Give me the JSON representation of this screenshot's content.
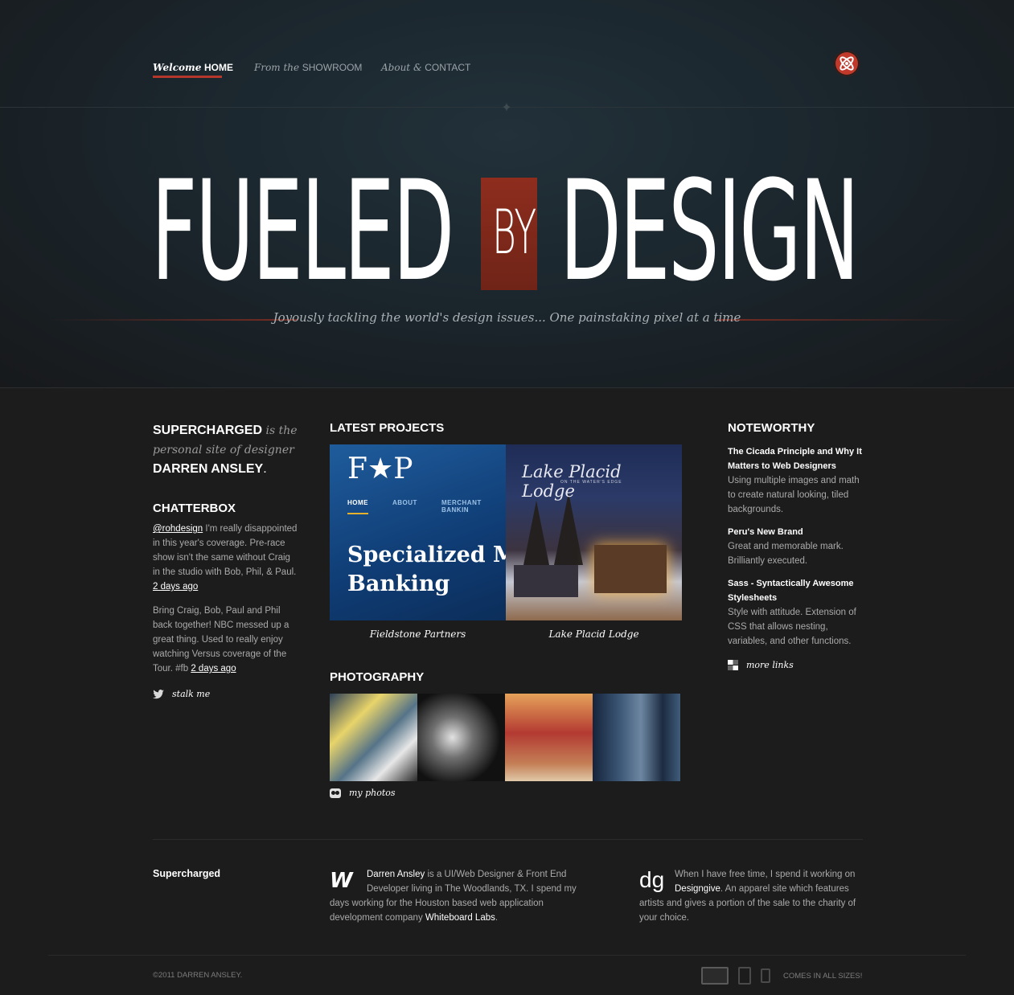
{
  "nav": {
    "items": [
      {
        "pre": "Welcome",
        "main": "HOME",
        "active": true
      },
      {
        "pre": "From the",
        "main": "SHOWROOM",
        "active": false
      },
      {
        "pre": "About &",
        "main": "CONTACT",
        "active": false
      }
    ],
    "logo_icon": "atom-logo-icon"
  },
  "hero": {
    "title_left": "FUELED",
    "title_by": "BY",
    "title_right": "DESIGN",
    "tagline": "Joyously tackling the world's design issues... One painstaking pixel at a time"
  },
  "intro": {
    "part1": "SUPERCHARGED",
    "part2": "is the personal site of designer",
    "part3": "DARREN ANSLEY",
    "part4": "."
  },
  "chatterbox": {
    "title": "CHATTERBOX",
    "tweets": [
      {
        "handle": "@rohdesign",
        "text": "I'm really disappointed in this year's coverage. Pre-race show isn't the same without Craig in the studio with Bob, Phil, & Paul.",
        "time": "2 days ago"
      },
      {
        "text": "Bring Craig, Bob, Paul and Phil back together! NBC messed up a great thing. Used to really enjoy watching Versus coverage of the Tour. #fb",
        "time": "2 days ago"
      }
    ],
    "stalk_label": "stalk me"
  },
  "projects": {
    "title": "LATEST PROJECTS",
    "items": [
      {
        "caption": "Fieldstone Partners",
        "logo": "F★P",
        "nav": [
          "HOME",
          "ABOUT",
          "MERCHANT BANKIN"
        ],
        "headline1": "Specialized Mer",
        "headline2": "Banking"
      },
      {
        "caption": "Lake Placid Lodge",
        "script": "Lake Placid Lodge",
        "sub": "ON THE WATER'S EDGE"
      }
    ]
  },
  "photography": {
    "title": "PHOTOGRAPHY",
    "link_label": "my photos"
  },
  "noteworthy": {
    "title": "NOTEWORTHY",
    "items": [
      {
        "title": "The Cicada Principle and Why It Matters to Web Designers",
        "text": "Using multiple images and math to create natural looking, tiled backgrounds."
      },
      {
        "title": "Peru's New Brand",
        "text": "Great and memorable mark. Brilliantly executed."
      },
      {
        "title": "Sass - Syntactically Awesome Stylesheets",
        "text": "Style with attitude. Extension of CSS that allows nesting, variables, and other functions."
      }
    ],
    "more_label": "more links"
  },
  "footer": {
    "name": "Supercharged",
    "mid_name": "Darren Ansley",
    "mid_text1": "is a UI/Web Designer & Front End Developer living in The Woodlands, TX. I spend my days working for the Houston based web application development company",
    "mid_link": "Whiteboard Labs",
    "mid_end": ".",
    "right_text1": "When I have free time, I spend it working on",
    "right_link": "Designgive",
    "right_text2": ". An apparel site which features artists and gives a portion of the sale to the charity of your choice.",
    "copyright": "©2011 DARREN ANSLEY.",
    "sizes_label": "COMES IN ALL SIZES!",
    "dg_logo": "dg"
  },
  "colors": {
    "accent": "#b5362a",
    "background": "#1c1c1c"
  }
}
